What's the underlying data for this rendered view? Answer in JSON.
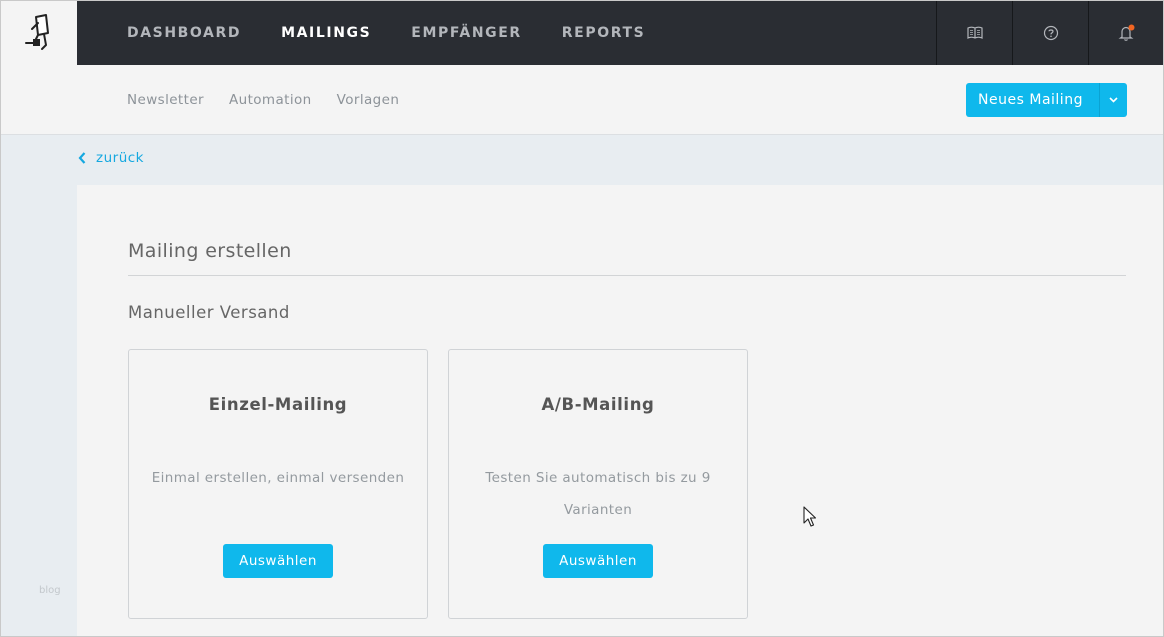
{
  "topnav": {
    "items": [
      "DASHBOARD",
      "MAILINGS",
      "EMPFÄNGER",
      "REPORTS"
    ],
    "active": 1,
    "icons": [
      "book-icon",
      "help-icon",
      "bell-icon"
    ]
  },
  "subnav": {
    "links": [
      "Newsletter",
      "Automation",
      "Vorlagen"
    ],
    "primary_button": "Neues Mailing"
  },
  "back": {
    "label": "zurück"
  },
  "sidebar": {
    "footer_text": "blog"
  },
  "main": {
    "title": "Mailing erstellen",
    "section": "Manueller Versand",
    "cards": [
      {
        "title": "Einzel-Mailing",
        "description": "Einmal erstellen, einmal versenden",
        "button": "Auswählen"
      },
      {
        "title": "A/B-Mailing",
        "description": "Testen Sie automatisch bis zu 9 Varianten",
        "button": "Auswählen"
      }
    ]
  },
  "colors": {
    "nav_bg": "#2a2d33",
    "accent": "#0fb8ec",
    "notification_dot": "#f26522",
    "panel_bg": "#f4f4f4",
    "page_bg": "#e8edf1"
  }
}
